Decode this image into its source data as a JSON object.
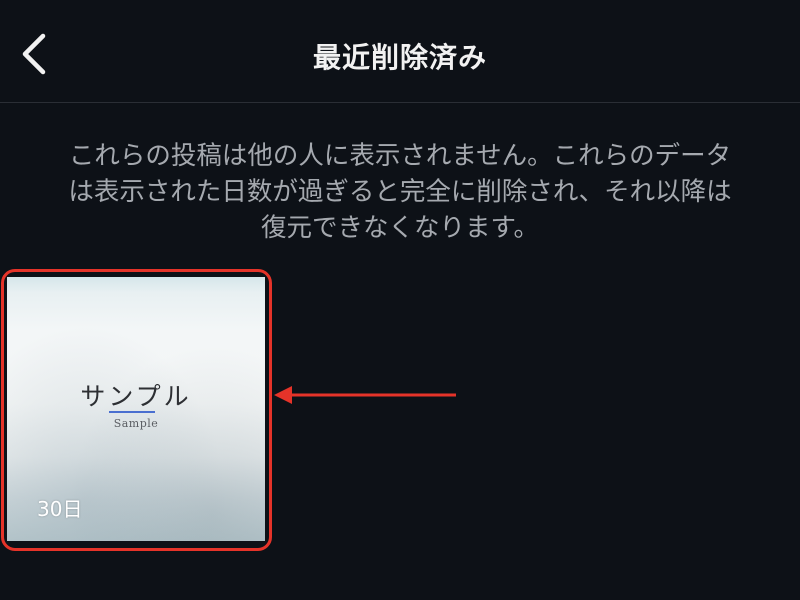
{
  "header": {
    "title": "最近削除済み",
    "back_icon": "chevron-left-icon"
  },
  "info": {
    "lines": [
      "これらの投稿は他の人に表示されません。これらのデータ",
      "は表示された日数が過ぎると完全に削除され、それ以降は",
      "復元できなくなります。"
    ]
  },
  "items": [
    {
      "thumbnail_title": "サンプル",
      "thumbnail_subtitle": "Sample",
      "days_remaining": "30日"
    }
  ],
  "annotation": {
    "highlight_color": "#e53329",
    "arrow_color": "#e53329"
  },
  "colors": {
    "background": "#0d1117",
    "title_text": "#f2f2f2",
    "info_text": "#a5a9af"
  }
}
